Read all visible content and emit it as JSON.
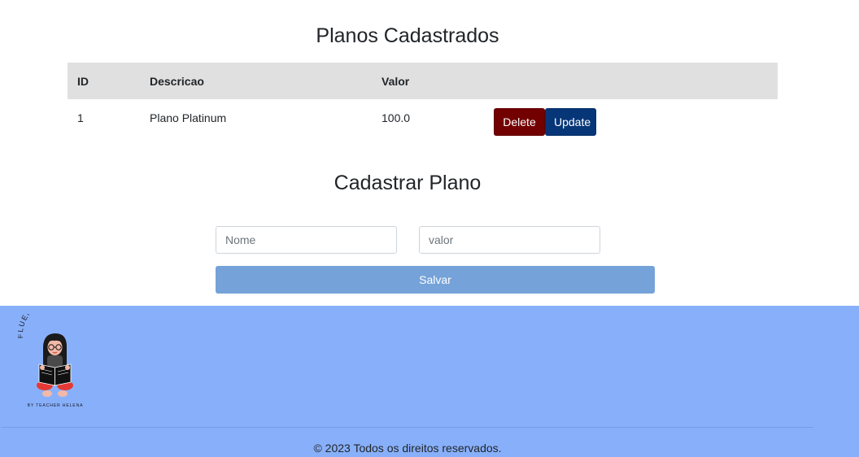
{
  "planos_section": {
    "title": "Planos Cadastrados",
    "columns": [
      "ID",
      "Descricao",
      "Valor"
    ],
    "rows": [
      {
        "id": "1",
        "descricao": "Plano Platinum",
        "valor": "100.0"
      }
    ],
    "delete_label": "Delete",
    "update_label": "Update"
  },
  "form": {
    "title": "Cadastrar Plano",
    "nome_placeholder": "Nome",
    "valor_placeholder": "valor",
    "submit_label": "Salvar"
  },
  "footer": {
    "logo_name": "FLUENCYNOW",
    "logo_tagline": "BY TEACHER HELENA",
    "copyright": "© 2023 Todos os direitos reservados."
  },
  "colors": {
    "delete": "#730000",
    "update": "#063678",
    "submit": "#75a2d8",
    "footer_bg": "#88b0fa",
    "table_header_bg": "#e0e0e0"
  }
}
